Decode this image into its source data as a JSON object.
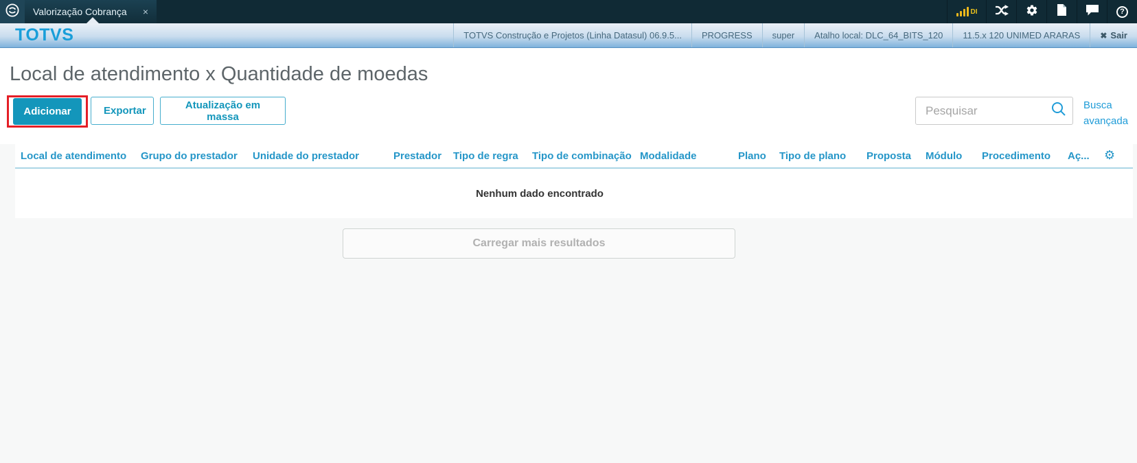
{
  "topbar": {
    "tab": {
      "label": "Valorização Cobrança",
      "close_icon": "×"
    },
    "signal": {
      "label": "DI"
    },
    "help": {
      "label": "?"
    }
  },
  "header": {
    "brand": "TOTVS",
    "info_items": [
      "TOTVS Construção e Projetos (Linha Datasul) 06.9.5...",
      "PROGRESS",
      "super",
      "Atalho local: DLC_64_BITS_120",
      "11.5.x 120 UNIMED ARARAS"
    ],
    "exit": {
      "icon": "✖",
      "label": "Sair"
    }
  },
  "page": {
    "title": "Local de atendimento x Quantidade de moedas",
    "toolbar": {
      "add_label": "Adicionar",
      "export_label": "Exportar",
      "bulk_update_label": "Atualização em massa",
      "search_placeholder": "Pesquisar",
      "advanced_search_label": "Busca avançada"
    },
    "table": {
      "columns": [
        "Local de atendimento",
        "Grupo do prestador",
        "Unidade do prestador",
        "Prestador",
        "Tipo de regra",
        "Tipo de combinação",
        "Modalidade",
        "Plano",
        "Tipo de plano",
        "Proposta",
        "Módulo",
        "Procedimento",
        "Aç...",
        "gear-icon"
      ],
      "empty_message": "Nenhum dado encontrado",
      "load_more_label": "Carregar mais resultados"
    },
    "colors": {
      "accent_teal": "#1396bb",
      "link_blue": "#1f9cd8",
      "table_header_blue": "#2596c8",
      "annotation_red": "#e41e26",
      "topbar_dark": "#102a35",
      "signal_yellow": "#f0b91c"
    }
  }
}
